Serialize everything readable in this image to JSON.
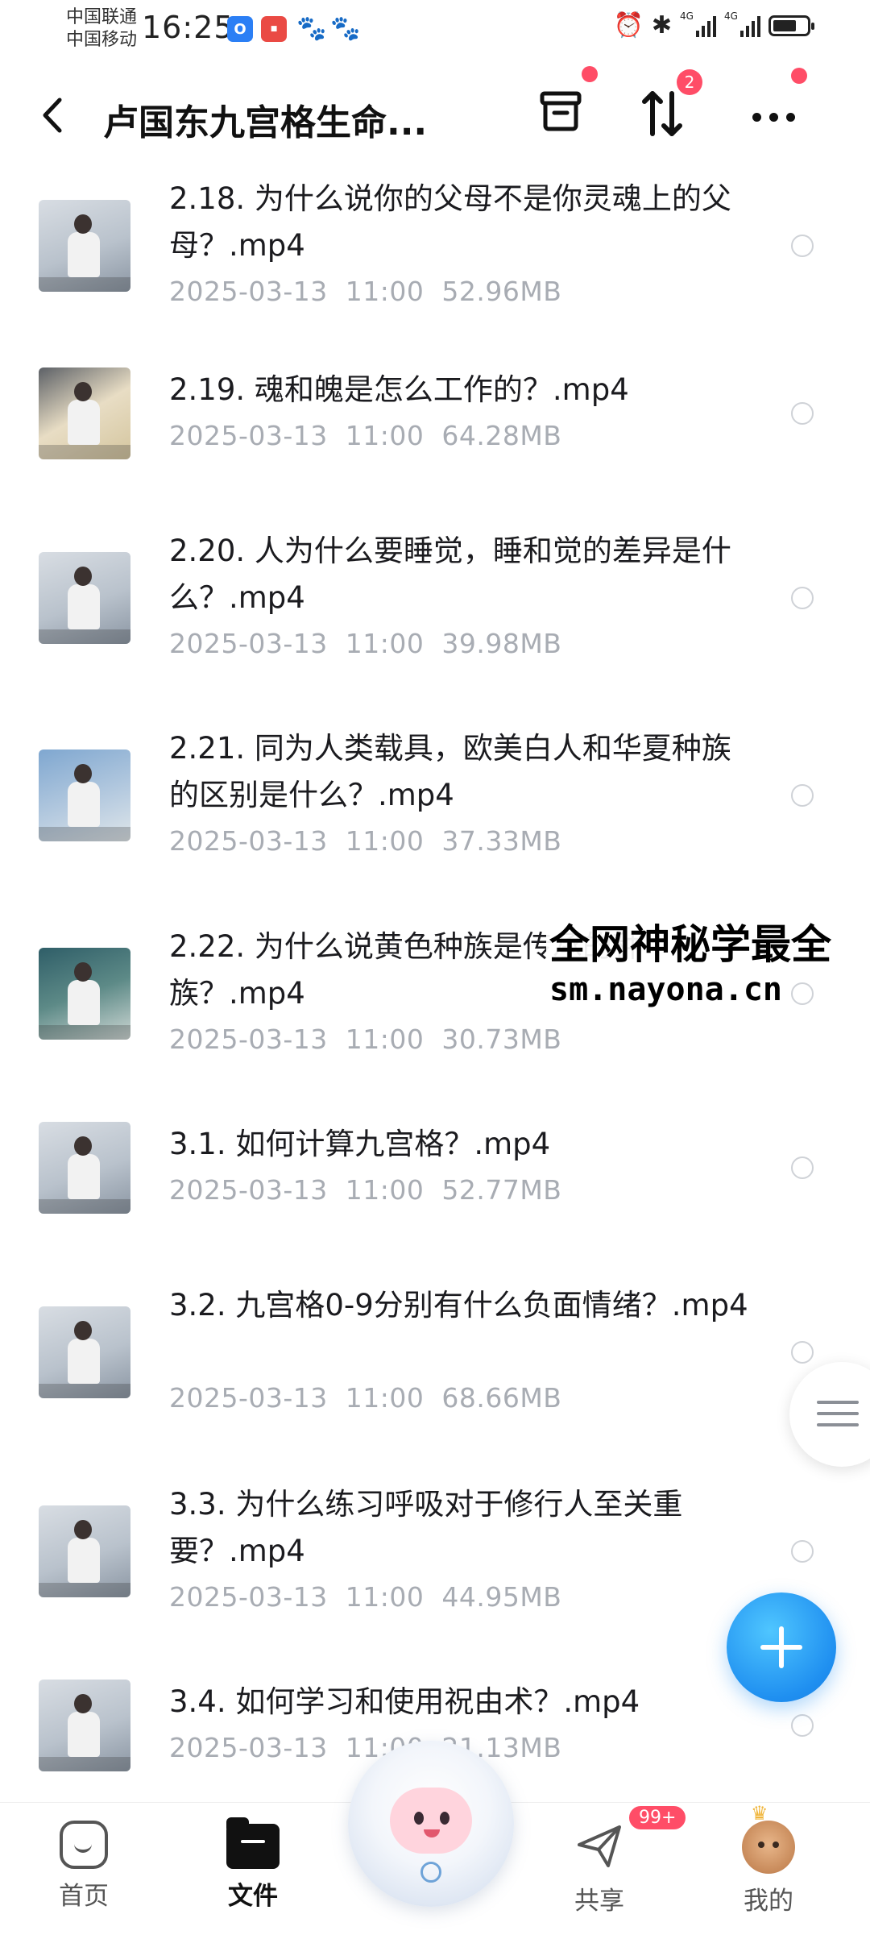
{
  "status_bar": {
    "carrier_1": "中国联通",
    "carrier_2": "中国移动",
    "time": "16:25",
    "network_1": "4G",
    "network_2": "4G",
    "battery_level": 0.7
  },
  "header": {
    "back_icon": "chevron-left-icon",
    "title": "卢国东九宫格生命...",
    "transfer_badge": "2"
  },
  "files": [
    {
      "name": "2.18. 为什么说你的父母不是你灵魂上的父母？.mp4",
      "date": "2025-03-13",
      "time": "11:00",
      "size": "52.96MB"
    },
    {
      "name": "2.19. 魂和魄是怎么工作的？.mp4",
      "date": "2025-03-13",
      "time": "11:00",
      "size": "64.28MB"
    },
    {
      "name": "2.20. 人为什么要睡觉，睡和觉的差异是什么？.mp4",
      "date": "2025-03-13",
      "time": "11:00",
      "size": "39.98MB"
    },
    {
      "name": "2.21. 同为人类载具，欧美白人和华夏种族的区别是什么？.mp4",
      "date": "2025-03-13",
      "time": "11:00",
      "size": "37.33MB"
    },
    {
      "name": "2.22. 为什么说黄色种族是传承的种族？.mp4",
      "date": "2025-03-13",
      "time": "11:00",
      "size": "30.73MB"
    },
    {
      "name": "3.1. 如何计算九宫格？.mp4",
      "date": "2025-03-13",
      "time": "11:00",
      "size": "52.77MB"
    },
    {
      "name": "3.2. 九宫格0-9分别有什么负面情绪？.mp4",
      "date": "2025-03-13",
      "time": "11:00",
      "size": "68.66MB"
    },
    {
      "name": "3.3. 为什么练习呼吸对于修行人至关重要？.mp4",
      "date": "2025-03-13",
      "time": "11:00",
      "size": "44.95MB"
    },
    {
      "name": "3.4. 如何学习和使用祝由术？.mp4",
      "date": "2025-03-13",
      "time": "11:00",
      "size": "21.13MB"
    }
  ],
  "watermark": {
    "line1": "全网神秘学最全",
    "line2": "sm.nayona.cn"
  },
  "bottom_nav": {
    "home": "首页",
    "files": "文件",
    "share": "共享",
    "share_badge": "99+",
    "mine": "我的"
  },
  "colors": {
    "accent": "#1f8ff0",
    "badge": "#ff4d67",
    "meta_text": "#a8acb3"
  }
}
